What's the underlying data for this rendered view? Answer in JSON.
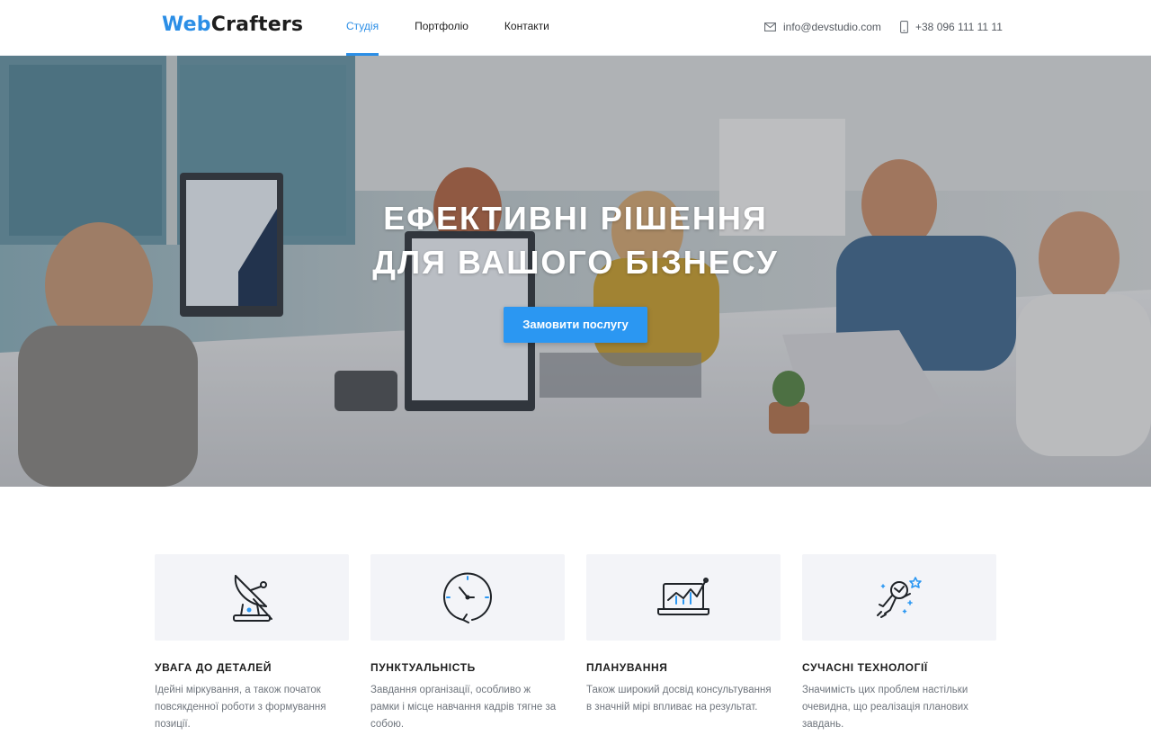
{
  "header": {
    "logo": {
      "part1": "Web",
      "part2": "Crafters"
    },
    "nav": [
      {
        "label": "Студія",
        "active": true
      },
      {
        "label": "Портфоліо",
        "active": false
      },
      {
        "label": "Контакти",
        "active": false
      }
    ],
    "email": {
      "icon": "envelope-icon",
      "text": "info@devstudio.com"
    },
    "phone": {
      "icon": "phone-icon",
      "text": "+38 096 111 11 11"
    }
  },
  "hero": {
    "title_line1": "ЕФЕКТИВНІ РІШЕННЯ",
    "title_line2": "ДЛЯ ВАШОГО БІЗНЕСУ",
    "button": "Замовити послугу"
  },
  "features": [
    {
      "icon": "satellite-dish-icon",
      "title": "УВАГА ДО ДЕТАЛЕЙ",
      "text": "Ідейні міркування, а також початок повсякденної роботи з формування позиції."
    },
    {
      "icon": "clock-icon",
      "title": "ПУНКТУАЛЬНІСТЬ",
      "text": "Завдання організації, особливо ж рамки і місце навчання кадрів тягне за собою."
    },
    {
      "icon": "laptop-chart-icon",
      "title": "ПЛАНУВАННЯ",
      "text": "Також широкий досвід консультування в значній мірі впливає на результат."
    },
    {
      "icon": "astronaut-icon",
      "title": "СУЧАСНІ ТЕХНОЛОГІЇ",
      "text": "Значимість цих проблем настільки очевидна, що реалізація планових завдань."
    }
  ],
  "colors": {
    "accent": "#2b8ee6",
    "button": "#2b97f2",
    "text": "#1e1e1e",
    "muted": "#6f757d",
    "card": "#f3f4f8"
  }
}
